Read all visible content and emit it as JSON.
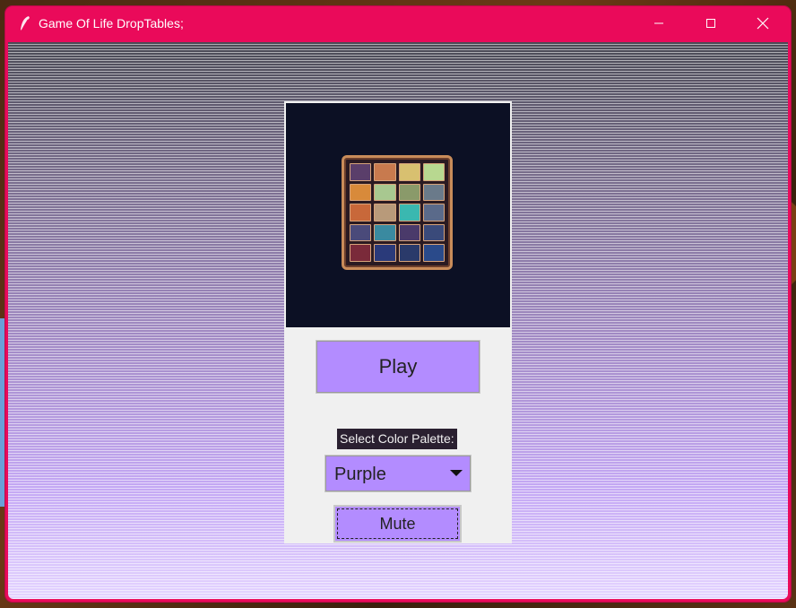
{
  "window": {
    "title": "Game Of Life DropTables;",
    "accent_color": "#ea0a5a",
    "icon": "feather-icon"
  },
  "controls": {
    "minimize_icon": "minimize-icon",
    "maximize_icon": "maximize-icon",
    "close_icon": "close-icon"
  },
  "main": {
    "logo_icon": "tile-grid-logo-icon",
    "play_label": "Play",
    "palette_label": "Select Color Palette:",
    "palette_selected": "Purple",
    "mute_label": "Mute",
    "button_color": "#b38cff"
  }
}
